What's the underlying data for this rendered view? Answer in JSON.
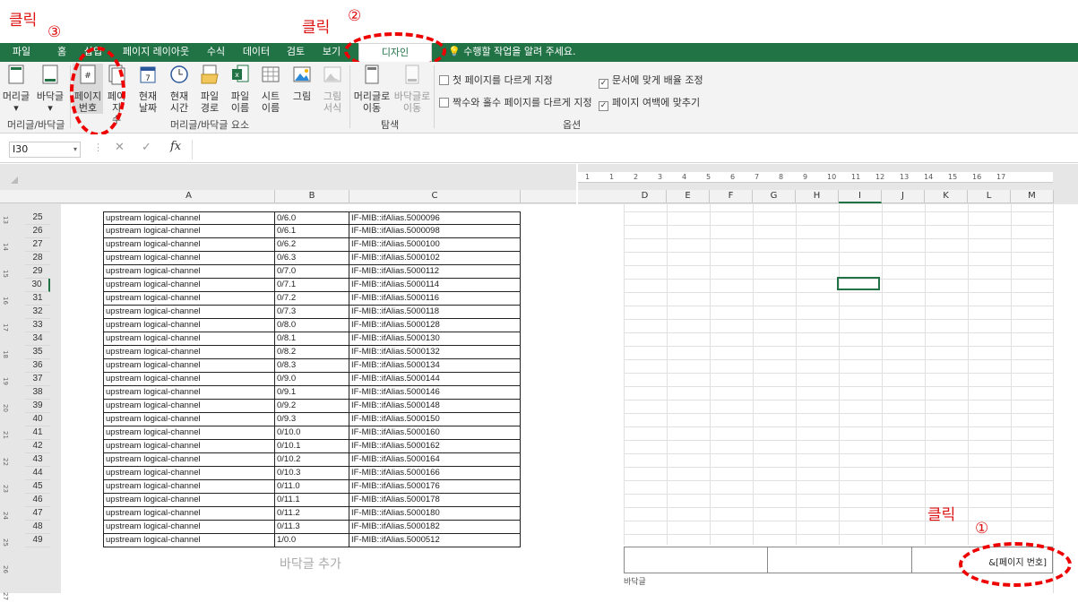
{
  "annotations": {
    "click_top_left": "클릭",
    "num3": "③",
    "click_top_mid": "클릭",
    "num2": "②",
    "click_bottom": "클릭",
    "num1": "①"
  },
  "tabs": [
    "파일",
    "홈",
    "삽입",
    "페이지 레이아웃",
    "수식",
    "데이터",
    "검토",
    "보기",
    "디자인"
  ],
  "tell_me": "수행할 작업을 알려 주세요.",
  "ribbon": {
    "buttons": [
      {
        "label1": "머리글",
        "label2": "▾"
      },
      {
        "label1": "바닥글",
        "label2": "▾"
      },
      {
        "label1": "페이지",
        "label2": "번호"
      },
      {
        "label1": "페이지",
        "label2": "수"
      },
      {
        "label1": "현재",
        "label2": "날짜"
      },
      {
        "label1": "현재",
        "label2": "시간"
      },
      {
        "label1": "파일",
        "label2": "경로"
      },
      {
        "label1": "파일",
        "label2": "이름"
      },
      {
        "label1": "시트",
        "label2": "이름"
      },
      {
        "label1": "그림",
        "label2": ""
      },
      {
        "label1": "그림",
        "label2": "서식"
      },
      {
        "label1": "머리글로",
        "label2": "이동"
      },
      {
        "label1": "바닥글로",
        "label2": "이동"
      }
    ],
    "groups": [
      "머리글/바닥글",
      "머리글/바닥글 요소",
      "탐색",
      "옵션"
    ],
    "options": [
      {
        "label": "첫 페이지를 다르게 지정",
        "checked": false
      },
      {
        "label": "짝수와 홀수 페이지를 다르게 지정",
        "checked": false
      },
      {
        "label": "문서에 맞게 배율 조정",
        "checked": true
      },
      {
        "label": "페이지 여백에 맞추기",
        "checked": true
      }
    ]
  },
  "formula_bar": {
    "name_box": "I30",
    "cancel": "✕",
    "enter": "✓",
    "fx": "fx",
    "value": ""
  },
  "left_columns": [
    "A",
    "B",
    "C"
  ],
  "right_columns": [
    "D",
    "E",
    "F",
    "G",
    "H",
    "I",
    "J",
    "K",
    "L",
    "M"
  ],
  "ruler_marks": [
    "1",
    "1",
    "2",
    "3",
    "4",
    "5",
    "6",
    "7",
    "8",
    "9",
    "10",
    "11",
    "12",
    "13",
    "14",
    "15",
    "16",
    "17"
  ],
  "rows": [
    {
      "n": "25",
      "a": "upstream logical-channel",
      "b": "0/6.0",
      "c": "IF-MIB::ifAlias.5000096"
    },
    {
      "n": "26",
      "a": "upstream logical-channel",
      "b": "0/6.1",
      "c": "IF-MIB::ifAlias.5000098"
    },
    {
      "n": "27",
      "a": "upstream logical-channel",
      "b": "0/6.2",
      "c": "IF-MIB::ifAlias.5000100"
    },
    {
      "n": "28",
      "a": "upstream logical-channel",
      "b": "0/6.3",
      "c": "IF-MIB::ifAlias.5000102"
    },
    {
      "n": "29",
      "a": "upstream logical-channel",
      "b": "0/7.0",
      "c": "IF-MIB::ifAlias.5000112"
    },
    {
      "n": "30",
      "a": "upstream logical-channel",
      "b": "0/7.1",
      "c": "IF-MIB::ifAlias.5000114"
    },
    {
      "n": "31",
      "a": "upstream logical-channel",
      "b": "0/7.2",
      "c": "IF-MIB::ifAlias.5000116"
    },
    {
      "n": "32",
      "a": "upstream logical-channel",
      "b": "0/7.3",
      "c": "IF-MIB::ifAlias.5000118"
    },
    {
      "n": "33",
      "a": "upstream logical-channel",
      "b": "0/8.0",
      "c": "IF-MIB::ifAlias.5000128"
    },
    {
      "n": "34",
      "a": "upstream logical-channel",
      "b": "0/8.1",
      "c": "IF-MIB::ifAlias.5000130"
    },
    {
      "n": "35",
      "a": "upstream logical-channel",
      "b": "0/8.2",
      "c": "IF-MIB::ifAlias.5000132"
    },
    {
      "n": "36",
      "a": "upstream logical-channel",
      "b": "0/8.3",
      "c": "IF-MIB::ifAlias.5000134"
    },
    {
      "n": "37",
      "a": "upstream logical-channel",
      "b": "0/9.0",
      "c": "IF-MIB::ifAlias.5000144"
    },
    {
      "n": "38",
      "a": "upstream logical-channel",
      "b": "0/9.1",
      "c": "IF-MIB::ifAlias.5000146"
    },
    {
      "n": "39",
      "a": "upstream logical-channel",
      "b": "0/9.2",
      "c": "IF-MIB::ifAlias.5000148"
    },
    {
      "n": "40",
      "a": "upstream logical-channel",
      "b": "0/9.3",
      "c": "IF-MIB::ifAlias.5000150"
    },
    {
      "n": "41",
      "a": "upstream logical-channel",
      "b": "0/10.0",
      "c": "IF-MIB::ifAlias.5000160"
    },
    {
      "n": "42",
      "a": "upstream logical-channel",
      "b": "0/10.1",
      "c": "IF-MIB::ifAlias.5000162"
    },
    {
      "n": "43",
      "a": "upstream logical-channel",
      "b": "0/10.2",
      "c": "IF-MIB::ifAlias.5000164"
    },
    {
      "n": "44",
      "a": "upstream logical-channel",
      "b": "0/10.3",
      "c": "IF-MIB::ifAlias.5000166"
    },
    {
      "n": "45",
      "a": "upstream logical-channel",
      "b": "0/11.0",
      "c": "IF-MIB::ifAlias.5000176"
    },
    {
      "n": "46",
      "a": "upstream logical-channel",
      "b": "0/11.1",
      "c": "IF-MIB::ifAlias.5000178"
    },
    {
      "n": "47",
      "a": "upstream logical-channel",
      "b": "0/11.2",
      "c": "IF-MIB::ifAlias.5000180"
    },
    {
      "n": "48",
      "a": "upstream logical-channel",
      "b": "0/11.3",
      "c": "IF-MIB::ifAlias.5000182"
    },
    {
      "n": "49",
      "a": "upstream logical-channel",
      "b": "1/0.0",
      "c": "IF-MIB::ifAlias.5000512"
    }
  ],
  "ruler_left": [
    "13",
    "14",
    "15",
    "16",
    "17",
    "18",
    "19",
    "20",
    "21",
    "22",
    "23",
    "24",
    "25",
    "26",
    "27"
  ],
  "footer_add": "바닥글 추가",
  "footer_field": "&[페이지 번호]",
  "footer_label": "바닥글",
  "colors": {
    "excel_green": "#217346",
    "annotation_red": "#dd1111"
  }
}
